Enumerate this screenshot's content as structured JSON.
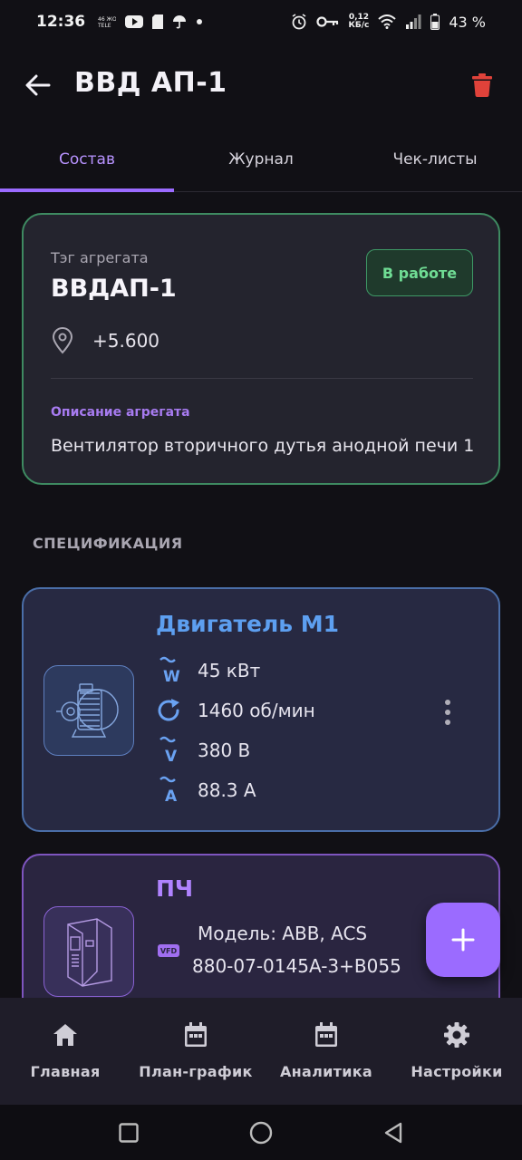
{
  "status_bar": {
    "time": "12:36",
    "speed_value": "0,12",
    "speed_unit": "КБ/с",
    "battery": "43 %"
  },
  "app_bar": {
    "title": "ВВД АП-1"
  },
  "tabs": [
    {
      "label": "Состав",
      "active": true
    },
    {
      "label": "Журнал",
      "active": false
    },
    {
      "label": "Чек-листы",
      "active": false
    }
  ],
  "aggregate": {
    "tag_label": "Тэг агрегата",
    "tag_value": "ВВДАП-1",
    "status": "В работе",
    "location": "+5.600",
    "description_label": "Описание агрегата",
    "description": "Вентилятор вторичного дутья анодной печи 1"
  },
  "specification": {
    "title": "СПЕЦИФИКАЦИЯ",
    "motor": {
      "name": "Двигатель М1",
      "specs": [
        {
          "icon": "power-icon",
          "symbol": "W",
          "value": "45 кВт"
        },
        {
          "icon": "rpm-icon",
          "symbol": "",
          "value": "1460 об/мин"
        },
        {
          "icon": "voltage-icon",
          "symbol": "V",
          "value": "380 В"
        },
        {
          "icon": "current-icon",
          "symbol": "A",
          "value": "88.3 А"
        }
      ]
    },
    "vfd": {
      "name": "ПЧ",
      "badge": "VFD",
      "model_line1": "Модель: ABB, ACS",
      "model_line2": "880-07-0145A-3+B055"
    }
  },
  "bottom_nav": [
    {
      "label": "Главная",
      "icon": "home-icon"
    },
    {
      "label": "План-график",
      "icon": "calendar-icon"
    },
    {
      "label": "Аналитика",
      "icon": "calendar-icon"
    },
    {
      "label": "Настройки",
      "icon": "gear-icon"
    }
  ],
  "colors": {
    "accent": "#9b6bff",
    "status_green": "#6fdc94",
    "motor_blue": "#5d9ff0",
    "delete_red": "#e0423a"
  }
}
